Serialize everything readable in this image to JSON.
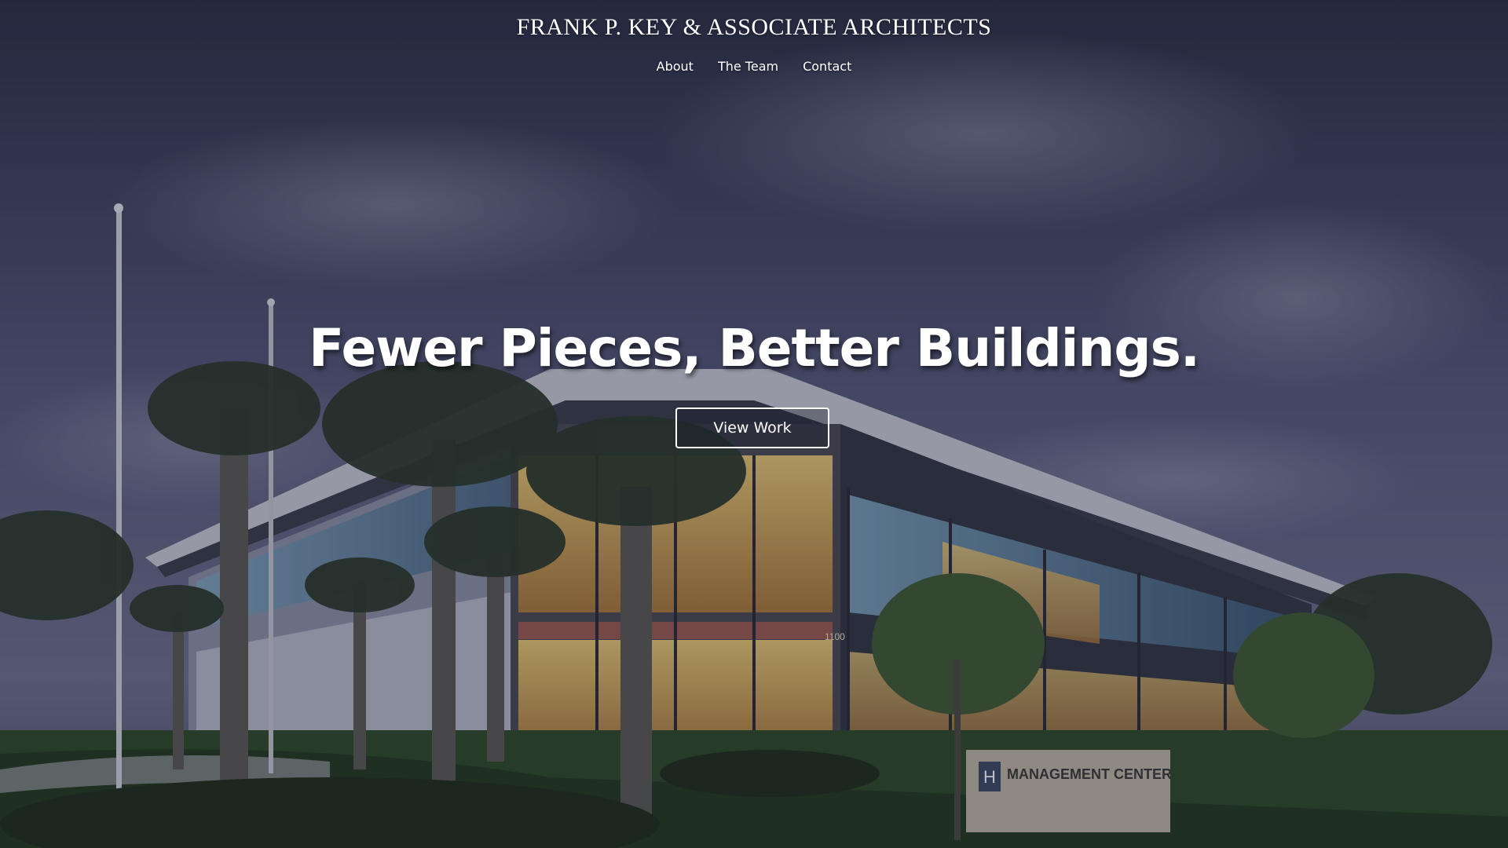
{
  "header": {
    "brand": "FRANK P. KEY & ASSOCIATE ARCHITECTS",
    "nav": [
      {
        "label": "About"
      },
      {
        "label": "The Team"
      },
      {
        "label": "Contact"
      }
    ]
  },
  "hero": {
    "headline": "Fewer Pieces, Better Buildings.",
    "cta_label": "View Work",
    "sign_text": "MANAGEMENT CENTER",
    "sign_letter": "H",
    "building_number": "1100"
  },
  "colors": {
    "sky_top": "#2b3046",
    "sky_mid": "#5a5d78",
    "glass_warm": "#d9b866",
    "glass_cool": "#5f8aa6",
    "grass": "#2e4a2a"
  }
}
